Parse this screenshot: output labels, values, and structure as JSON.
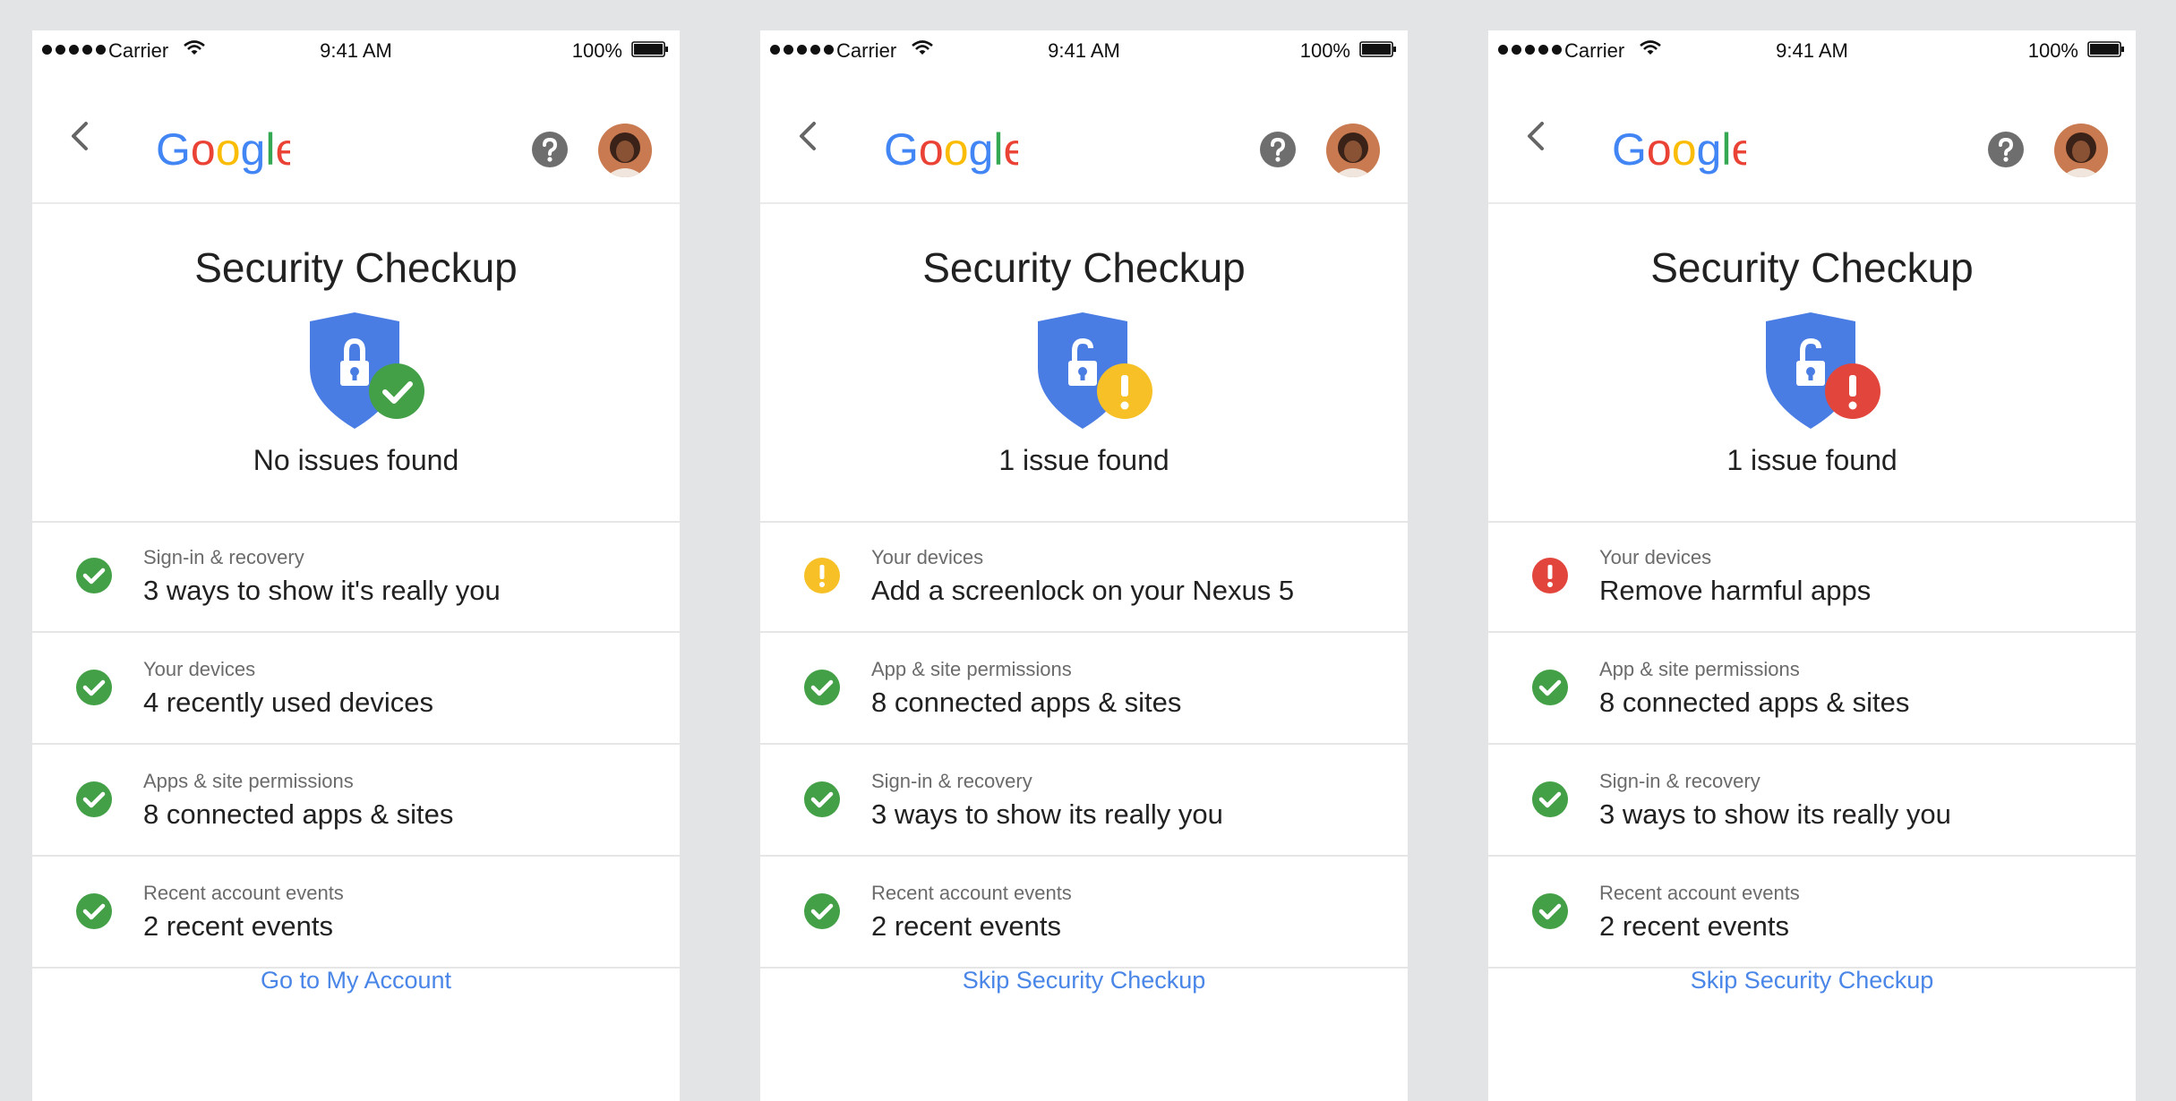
{
  "colors": {
    "background": "#e3e4e6",
    "shield_blue": "#4a7de3",
    "success_green": "#43a047",
    "warning_yellow": "#f6c026",
    "error_red": "#e2453c",
    "link_blue": "#4a86e8"
  },
  "screens": [
    {
      "status_bar": {
        "carrier": "Carrier",
        "time": "9:41 AM",
        "battery": "100%"
      },
      "header": {
        "logo": "Google",
        "back_icon": "chevron-left-icon",
        "help_icon": "help-icon",
        "avatar": "avatar-icon"
      },
      "title": "Security Checkup",
      "shield": {
        "lock": "locked",
        "badge": "check",
        "badge_color": "#43a047"
      },
      "summary": "No issues found",
      "items": [
        {
          "status": "ok",
          "category": "Sign-in & recovery",
          "detail": "3 ways to show it's really you"
        },
        {
          "status": "ok",
          "category": "Your devices",
          "detail": "4 recently used devices"
        },
        {
          "status": "ok",
          "category": "Apps & site permissions",
          "detail": "8 connected apps & sites"
        },
        {
          "status": "ok",
          "category": "Recent account events",
          "detail": "2 recent events"
        }
      ],
      "footer_link": "Go to My Account"
    },
    {
      "status_bar": {
        "carrier": "Carrier",
        "time": "9:41 AM",
        "battery": "100%"
      },
      "header": {
        "logo": "Google",
        "back_icon": "chevron-left-icon",
        "help_icon": "help-icon",
        "avatar": "avatar-icon"
      },
      "title": "Security Checkup",
      "shield": {
        "lock": "unlocked",
        "badge": "warning",
        "badge_color": "#f6c026"
      },
      "summary": "1 issue found",
      "items": [
        {
          "status": "warning",
          "category": "Your devices",
          "detail": "Add a screenlock on your Nexus 5"
        },
        {
          "status": "ok",
          "category": "App & site permissions",
          "detail": "8 connected apps & sites"
        },
        {
          "status": "ok",
          "category": "Sign-in & recovery",
          "detail": "3 ways to show its really you"
        },
        {
          "status": "ok",
          "category": "Recent account events",
          "detail": "2 recent events"
        }
      ],
      "footer_link": "Skip Security Checkup"
    },
    {
      "status_bar": {
        "carrier": "Carrier",
        "time": "9:41 AM",
        "battery": "100%"
      },
      "header": {
        "logo": "Google",
        "back_icon": "chevron-left-icon",
        "help_icon": "help-icon",
        "avatar": "avatar-icon"
      },
      "title": "Security Checkup",
      "shield": {
        "lock": "unlocked",
        "badge": "error",
        "badge_color": "#e2453c"
      },
      "summary": "1 issue found",
      "items": [
        {
          "status": "error",
          "category": "Your devices",
          "detail": "Remove harmful apps"
        },
        {
          "status": "ok",
          "category": "App & site permissions",
          "detail": "8 connected apps & sites"
        },
        {
          "status": "ok",
          "category": "Sign-in & recovery",
          "detail": "3 ways to show its really you"
        },
        {
          "status": "ok",
          "category": "Recent account events",
          "detail": "2 recent events"
        }
      ],
      "footer_link": "Skip Security Checkup"
    }
  ]
}
